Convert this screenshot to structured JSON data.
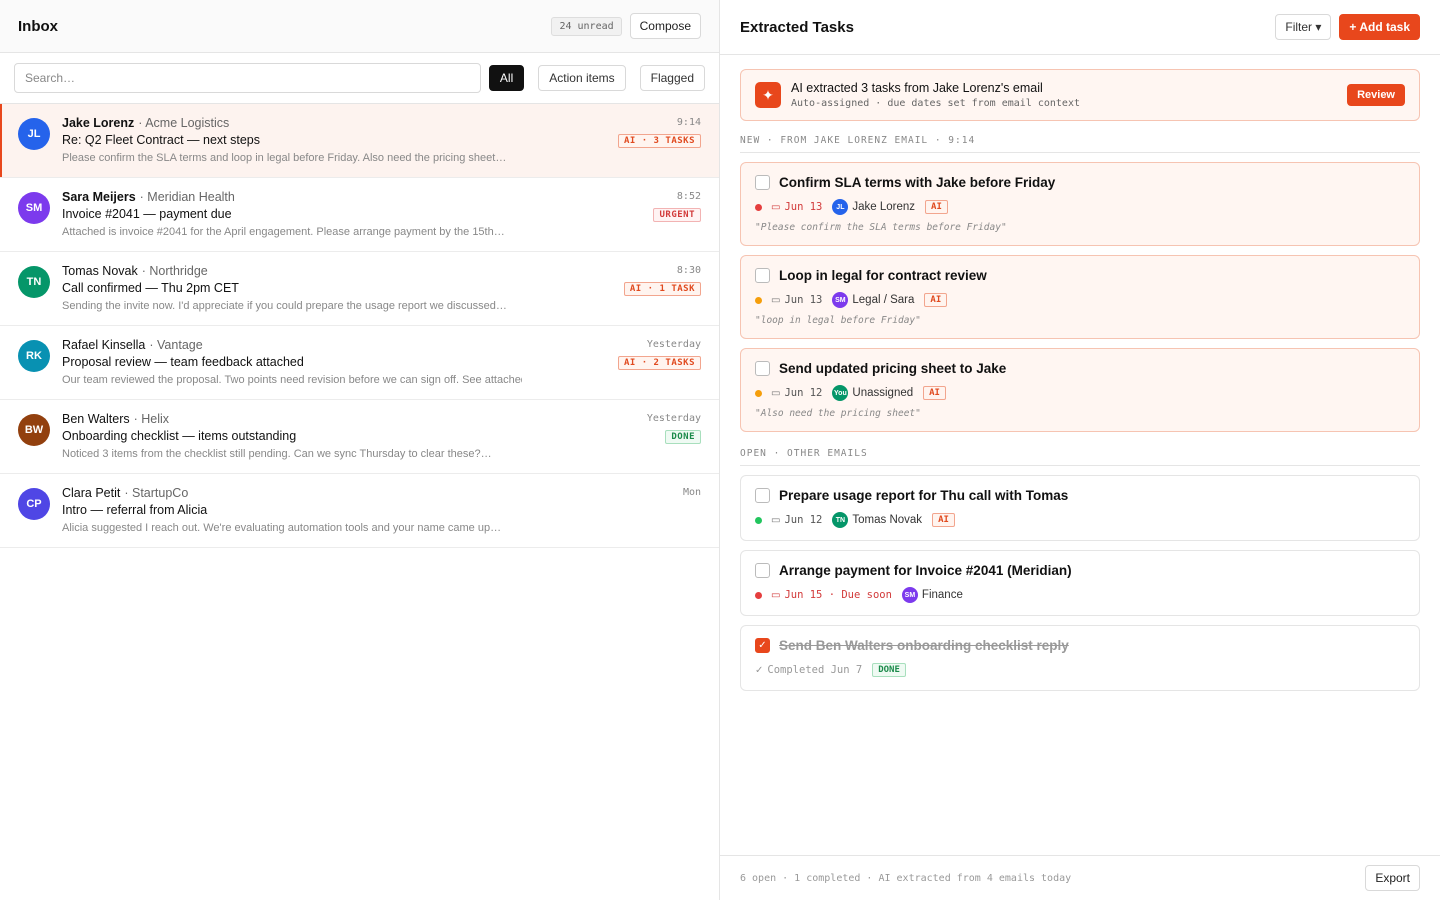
{
  "inbox": {
    "title": "Inbox",
    "unread": "24 unread",
    "compose_label": "Compose",
    "search_placeholder": "Search…",
    "filters": [
      "All",
      "Action items",
      "Flagged"
    ],
    "emails": [
      {
        "initials": "JL",
        "avatar_color": "#2563eb",
        "sender": "Jake Lorenz",
        "company": "· Acme Logistics",
        "subject": "Re: Q2 Fleet Contract — next steps",
        "preview": "Please confirm the SLA terms and loop in legal before Friday. Also need the pricing sheet…",
        "time": "9:14",
        "tag": "AI · 3 TASKS",
        "tag_type": "ai"
      },
      {
        "initials": "SM",
        "avatar_color": "#7c3aed",
        "sender": "Sara Meijers",
        "company": "· Meridian Health",
        "subject": "Invoice #2041 — payment due",
        "preview": "Attached is invoice #2041 for the April engagement. Please arrange payment by the 15th…",
        "time": "8:52",
        "tag": "URGENT",
        "tag_type": "urgent"
      },
      {
        "initials": "TN",
        "avatar_color": "#059669",
        "sender": "Tomas Novak",
        "company": "· Northridge",
        "subject": "Call confirmed — Thu 2pm CET",
        "preview": "Sending the invite now. I'd appreciate if you could prepare the usage report we discussed…",
        "time": "8:30",
        "tag": "AI · 1 TASK",
        "tag_type": "ai"
      },
      {
        "initials": "RK",
        "avatar_color": "#0891b2",
        "sender": "Rafael Kinsella",
        "company": "· Vantage",
        "subject": "Proposal review — team feedback attached",
        "preview": "Our team reviewed the proposal. Two points need revision before we can sign off. See attached…",
        "time": "Yesterday",
        "tag": "AI · 2 TASKS",
        "tag_type": "ai"
      },
      {
        "initials": "BW",
        "avatar_color": "#92400e",
        "sender": "Ben Walters",
        "company": "· Helix",
        "subject": "Onboarding checklist — items outstanding",
        "preview": "Noticed 3 items from the checklist still pending. Can we sync Thursday to clear these?…",
        "time": "Yesterday",
        "tag": "DONE",
        "tag_type": "done"
      },
      {
        "initials": "CP",
        "avatar_color": "#4f46e5",
        "sender": "Clara Petit",
        "company": "· StartupCo",
        "subject": "Intro — referral from Alicia",
        "preview": "Alicia suggested I reach out. We're evaluating automation tools and your name came up…",
        "time": "Mon",
        "tag": "",
        "tag_type": ""
      }
    ]
  },
  "tasks": {
    "title": "Extracted Tasks",
    "filter_label": "Filter ▾",
    "add_label": "+ Add task",
    "banner": {
      "title": "AI extracted 3 tasks from Jake Lorenz's email",
      "subtitle": "Auto-assigned · due dates set from email context",
      "review_label": "Review"
    },
    "section_new": "NEW · FROM JAKE LORENZ EMAIL · 9:14",
    "section_open": "OPEN · OTHER EMAILS",
    "new_tasks": [
      {
        "title": "Confirm SLA terms with Jake before Friday",
        "priority_color": "#e53e3e",
        "due": "Jun 13",
        "due_red": true,
        "assignee_initials": "JL",
        "assignee_color": "#2563eb",
        "assignee": "Jake Lorenz",
        "ai": "AI",
        "quote": "\"Please confirm the SLA terms before Friday\""
      },
      {
        "title": "Loop in legal for contract review",
        "priority_color": "#f59e0b",
        "due": "Jun 13",
        "due_red": false,
        "assignee_initials": "SM",
        "assignee_color": "#7c3aed",
        "assignee": "Legal / Sara",
        "ai": "AI",
        "quote": "\"loop in legal before Friday\""
      },
      {
        "title": "Send updated pricing sheet to Jake",
        "priority_color": "#f59e0b",
        "due": "Jun 12",
        "due_red": false,
        "assignee_initials": "You",
        "assignee_color": "#059669",
        "assignee": "Unassigned",
        "ai": "AI",
        "quote": "\"Also need the pricing sheet\""
      }
    ],
    "open_tasks": [
      {
        "title": "Prepare usage report for Thu call with Tomas",
        "priority_color": "#22c55e",
        "due": "Jun 12",
        "assignee_initials": "TN",
        "assignee_color": "#059669",
        "assignee": "Tomas Novak",
        "ai": "AI"
      },
      {
        "title": "Arrange payment for Invoice #2041 (Meridian)",
        "priority_color": "#e53e3e",
        "due": "Jun 15 · Due soon",
        "assignee_initials": "SM",
        "assignee_color": "#7c3aed",
        "assignee": "Finance",
        "ai": ""
      }
    ],
    "done_task": {
      "title": "Send Ben Walters onboarding checklist reply",
      "completed": "Completed Jun 7",
      "tag": "DONE"
    },
    "footer_stats": "6 open · 1 completed · AI extracted from 4 emails today",
    "export_label": "Export"
  }
}
